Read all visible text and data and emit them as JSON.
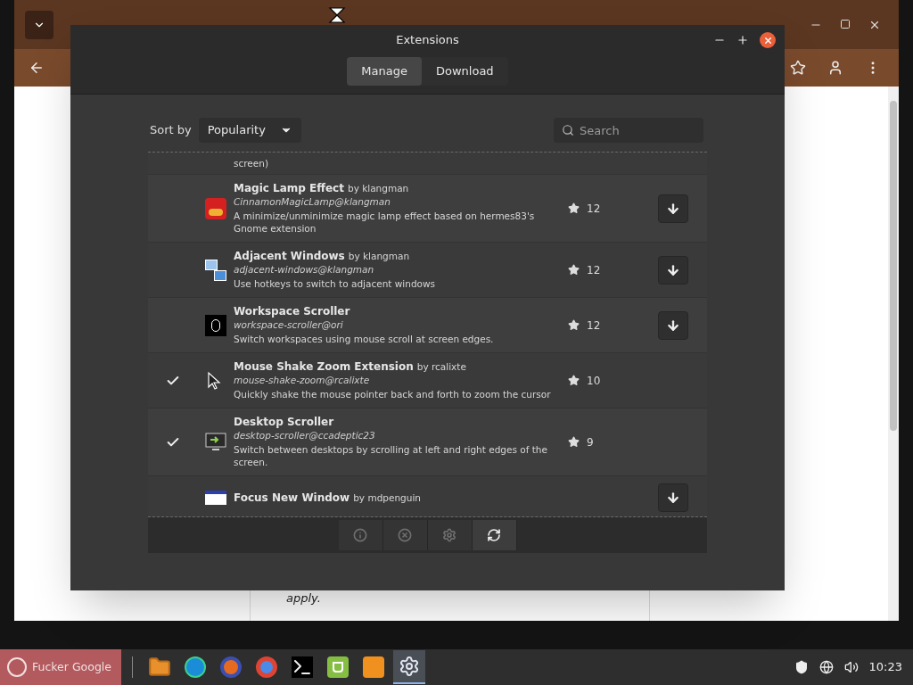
{
  "browser": {
    "page_text": "apply."
  },
  "dialog": {
    "title": "Extensions",
    "tabs": [
      {
        "label": "Manage",
        "selected": true
      },
      {
        "label": "Download",
        "selected": false
      }
    ],
    "sort": {
      "label": "Sort by",
      "value": "Popularity"
    },
    "search": {
      "placeholder": "Search"
    },
    "extensions": [
      {
        "description": "screen)",
        "installed": false,
        "download": false
      },
      {
        "name": "Magic Lamp Effect",
        "author": "by klangman",
        "uuid": "CinnamonMagicLamp@klangman",
        "description": "A minimize/unminimize magic lamp effect based on hermes83's Gnome extension",
        "stars": "12",
        "installed": false,
        "download": true
      },
      {
        "name": "Adjacent Windows",
        "author": "by klangman",
        "uuid": "adjacent-windows@klangman",
        "description": "Use hotkeys to switch to adjacent windows",
        "stars": "12",
        "installed": false,
        "download": true
      },
      {
        "name": "Workspace Scroller",
        "uuid": "workspace-scroller@ori",
        "description": "Switch workspaces using mouse scroll at screen edges.",
        "stars": "12",
        "installed": false,
        "download": true
      },
      {
        "name": "Mouse Shake Zoom Extension",
        "author": "by rcalixte",
        "uuid": "mouse-shake-zoom@rcalixte",
        "description": "Quickly shake the mouse pointer back and forth to zoom the cursor",
        "stars": "10",
        "installed": true,
        "download": false
      },
      {
        "name": "Desktop Scroller",
        "uuid": "desktop-scroller@ccadeptic23",
        "description": "Switch between desktops by scrolling at left and right edges of the screen.",
        "stars": "9",
        "installed": true,
        "download": false
      },
      {
        "name": "Focus New Window",
        "author": "by mdpenguin",
        "installed": false,
        "download": true
      }
    ],
    "toolbar": [
      {
        "kind": "info",
        "disabled": true
      },
      {
        "kind": "remove",
        "disabled": true
      },
      {
        "kind": "settings",
        "disabled": true
      },
      {
        "kind": "refresh",
        "disabled": false
      }
    ]
  },
  "taskbar": {
    "menu_label": "Fucker Google",
    "apps": [
      {
        "kind": "folder",
        "selected": false
      },
      {
        "kind": "edge",
        "selected": false
      },
      {
        "kind": "firefox",
        "selected": false
      },
      {
        "kind": "chrome",
        "selected": false
      },
      {
        "kind": "terminal",
        "selected": false
      },
      {
        "kind": "mint",
        "selected": false
      },
      {
        "kind": "orange",
        "selected": false
      },
      {
        "kind": "gear",
        "selected": true
      }
    ],
    "clock": "10:23"
  }
}
